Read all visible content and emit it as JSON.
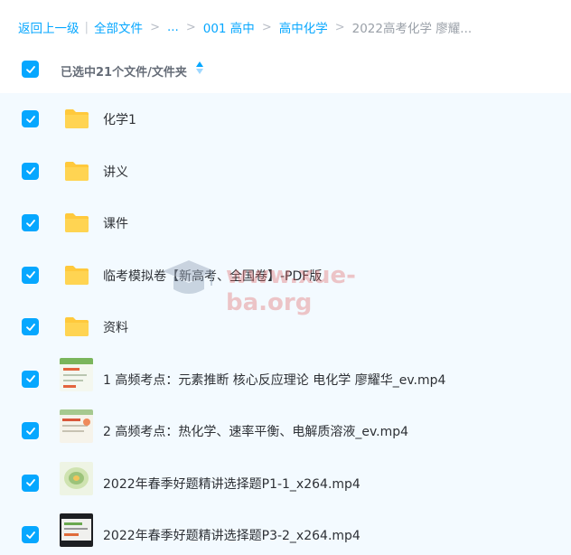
{
  "breadcrumb": {
    "back": "返回上一级",
    "all_files": "全部文件",
    "ellipsis": "...",
    "level1": "001 高中",
    "level2": "高中化学",
    "current": "2022高考化学 廖耀..."
  },
  "header": {
    "selected_label": "已选中21个文件/文件夹"
  },
  "files": [
    {
      "type": "folder",
      "name": "化学1",
      "checked": true
    },
    {
      "type": "folder",
      "name": "讲义",
      "checked": true
    },
    {
      "type": "folder",
      "name": "课件",
      "checked": true
    },
    {
      "type": "folder",
      "name": "临考模拟卷【新高考、全国卷】-PDF版",
      "checked": true
    },
    {
      "type": "folder",
      "name": "资料",
      "checked": true
    },
    {
      "type": "video",
      "name": "1 高频考点：元素推断 核心反应理论 电化学 廖耀华_ev.mp4",
      "checked": true
    },
    {
      "type": "video",
      "name": "2 高频考点：热化学、速率平衡、电解质溶液_ev.mp4",
      "checked": true
    },
    {
      "type": "video",
      "name": "2022年春季好题精讲选择题P1-1_x264.mp4",
      "checked": true
    },
    {
      "type": "video",
      "name": "2022年春季好题精讲选择题P3-2_x264.mp4",
      "checked": true
    }
  ],
  "watermark": {
    "text": "www.xue-ba.org"
  },
  "colors": {
    "accent": "#06a7ff",
    "folder": "#ffc93c",
    "list_bg": "#f3faff"
  }
}
